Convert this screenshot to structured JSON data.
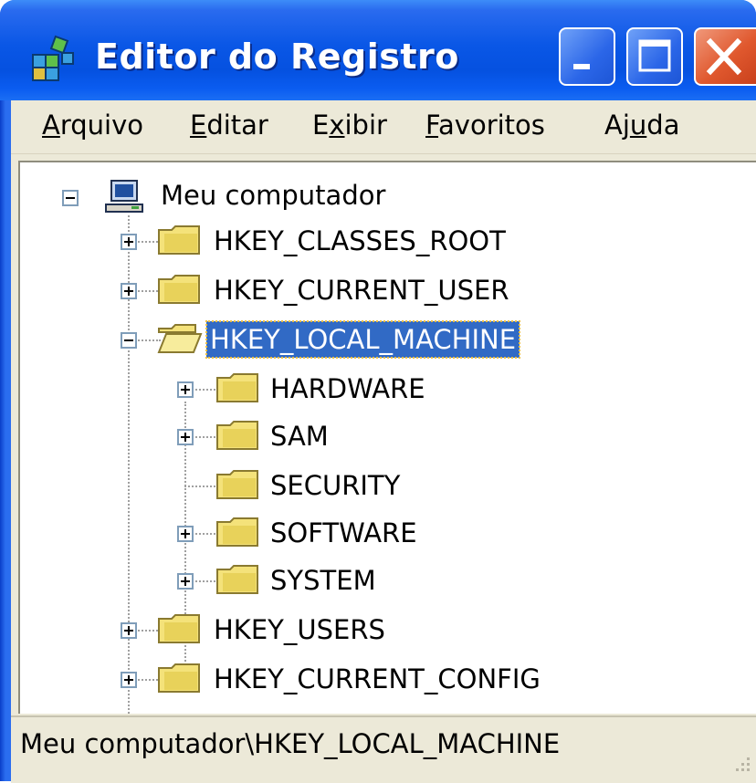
{
  "window": {
    "title": "Editor do Registro",
    "icon": "registry-editor-icon"
  },
  "menu": {
    "items": [
      {
        "label": "Arquivo",
        "accel": "A"
      },
      {
        "label": "Editar",
        "accel": "E"
      },
      {
        "label": "Exibir",
        "accel": "x"
      },
      {
        "label": "Favoritos",
        "accel": "F"
      },
      {
        "label": "Ajuda",
        "accel": "u"
      }
    ]
  },
  "tree": {
    "root": "Meu computador",
    "hives": [
      {
        "label": "HKEY_CLASSES_ROOT",
        "state": "collapsed"
      },
      {
        "label": "HKEY_CURRENT_USER",
        "state": "collapsed"
      },
      {
        "label": "HKEY_LOCAL_MACHINE",
        "state": "expanded",
        "selected": true
      },
      {
        "label": "HKEY_USERS",
        "state": "collapsed"
      },
      {
        "label": "HKEY_CURRENT_CONFIG",
        "state": "collapsed"
      }
    ],
    "local_machine_children": [
      {
        "label": "HARDWARE",
        "expandable": true
      },
      {
        "label": "SAM",
        "expandable": true
      },
      {
        "label": "SECURITY",
        "expandable": false
      },
      {
        "label": "SOFTWARE",
        "expandable": true
      },
      {
        "label": "SYSTEM",
        "expandable": true
      }
    ]
  },
  "status": {
    "path": "Meu computador\\HKEY_LOCAL_MACHINE"
  },
  "colors": {
    "titlebar": "#0a57e6",
    "selection": "#316ac5",
    "close_button": "#e0582e",
    "folder": "#f4e27a"
  }
}
